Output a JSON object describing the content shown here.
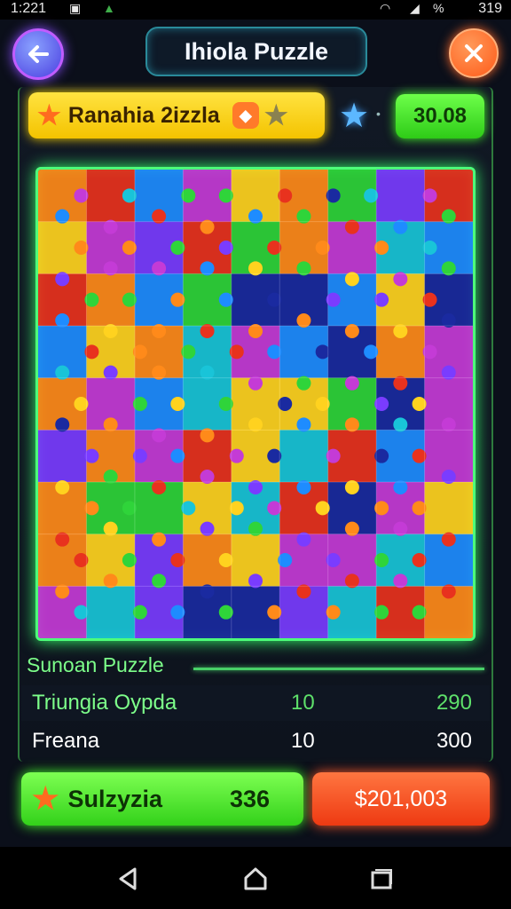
{
  "status_bar": {
    "time": "1:221",
    "right_text": "319",
    "percent_text": "%"
  },
  "header": {
    "title": "Ihiola Puzzle",
    "back_icon": "arrow-left-icon",
    "close_icon": "close-icon",
    "colors": {
      "back": "#5a4bff",
      "close": "#ff5a18"
    }
  },
  "level_bar": {
    "label": "Ranahia 2izzla",
    "score": "30.08"
  },
  "board": {
    "rows": 9,
    "cols": 9,
    "palette": [
      "#2fd43a",
      "#1e8cff",
      "#c43bd6",
      "#ffd21f",
      "#ff8a1a",
      "#e8321e",
      "#19c4d8",
      "#7a3cff",
      "#1a2aa0"
    ]
  },
  "stats": {
    "section_title": "Sunoan Puzzle",
    "rows": [
      {
        "name": "Triungia Oypda",
        "v1": "10",
        "v2": "290"
      },
      {
        "name": "Freana",
        "v1": "10",
        "v2": "300"
      }
    ]
  },
  "actions": {
    "primary_label": "Sulzyzia",
    "primary_count": "336",
    "secondary_label": "$201,003"
  }
}
